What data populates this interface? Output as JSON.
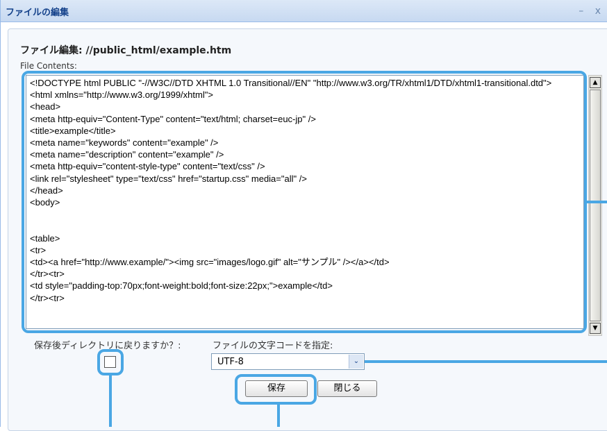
{
  "window": {
    "title": "ファイルの編集",
    "controls": "– x"
  },
  "form": {
    "heading": "ファイル編集: //public_html/example.htm",
    "contents_label": "File Contents:",
    "file_contents": "<!DOCTYPE html PUBLIC \"-//W3C//DTD XHTML 1.0 Transitional//EN\" \"http://www.w3.org/TR/xhtml1/DTD/xhtml1-transitional.dtd\">\n<html xmlns=\"http://www.w3.org/1999/xhtml\">\n<head>\n<meta http-equiv=\"Content-Type\" content=\"text/html; charset=euc-jp\" />\n<title>example</title>\n<meta name=\"keywords\" content=\"example\" />\n<meta name=\"description\" content=\"example\" />\n<meta http-equiv=\"content-style-type\" content=\"text/css\" />\n<link rel=\"stylesheet\" type=\"text/css\" href=\"startup.css\" media=\"all\" />\n</head>\n<body>\n\n\n<table>\n<tr>\n<td><a href=\"http://www.example/\"><img src=\"images/logo.gif\" alt=\"サンプル\" /></a></td>\n</tr><tr>\n<td style=\"padding-top:70px;font-weight:bold;font-size:22px;\">example</td>\n</tr><tr>",
    "return_label": "保存後ディレクトリに戻りますか？:",
    "return_checked": false,
    "encoding_label": "ファイルの文字コードを指定:",
    "encoding_value": "UTF-8",
    "save_label": "保存",
    "close_label": "閉じる"
  },
  "scrollbar": {
    "up_icon": "▲",
    "down_icon": "▼"
  },
  "dropdown_icon": "⌄",
  "colors": {
    "highlight": "#4aa7e4",
    "title_text": "#15428b"
  }
}
